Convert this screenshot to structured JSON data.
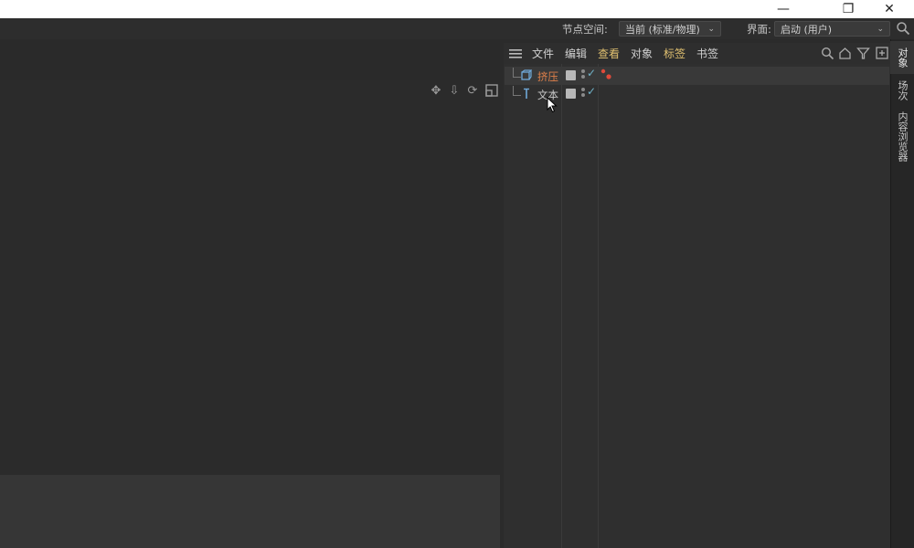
{
  "window": {
    "minimize": "—",
    "restore": "❐",
    "close": "✕"
  },
  "toolbar": {
    "node_space_label": "节点空间:",
    "node_space_value": "当前 (标准/物理)",
    "layout_label": "界面:",
    "layout_value": "启动 (用户)"
  },
  "object_manager": {
    "menu": [
      "文件",
      "编辑",
      "查看",
      "对象",
      "标签",
      "书签"
    ],
    "highlighted": [
      "查看",
      "标签"
    ],
    "objects": [
      {
        "name": "挤压",
        "icon": "extrude-icon",
        "selected": true,
        "name_color": "#e0804a"
      },
      {
        "name": "文本",
        "icon": "text-spline-icon",
        "selected": false,
        "name_color": "#c8c8c8"
      }
    ]
  },
  "side_tabs": [
    "对象",
    "场次",
    "内容浏览器"
  ]
}
